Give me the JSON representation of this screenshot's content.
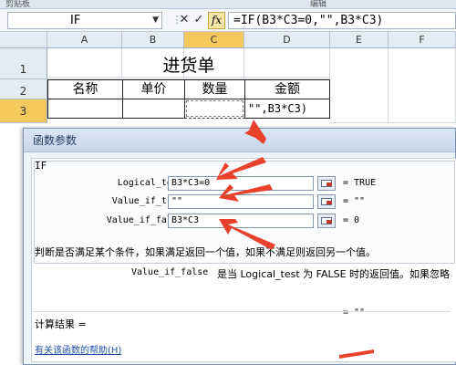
{
  "ribbon": {
    "left_label": "剪贴板",
    "right_label": "编辑"
  },
  "formula_bar": {
    "name_box": "IF",
    "cancel_glyph": "✕",
    "enter_glyph": "✓",
    "fx_label": "fx",
    "formula": "=IF(B3*C3=0,\"\",B3*C3)"
  },
  "sheet": {
    "columns": [
      "A",
      "B",
      "C",
      "D",
      "E",
      "F"
    ],
    "rows": [
      "1",
      "2",
      "3"
    ],
    "title": "进货单",
    "headers": [
      "名称",
      "单价",
      "数量",
      "金额"
    ],
    "cell_d3": "\"\",B3*C3)"
  },
  "dialog": {
    "title": "函数参数",
    "function_name": "IF",
    "args": [
      {
        "label": "Logical_test",
        "value": "B3*C3=0",
        "result": "=  TRUE"
      },
      {
        "label": "Value_if_true",
        "value": "\"\"",
        "result": "=  \"\""
      },
      {
        "label": "Value_if_false",
        "value": "B3*C3",
        "result": "=  0"
      }
    ],
    "overall_result": "=  \"\"",
    "description": "判断是否满足某个条件，如果满足返回一个值，如果不满足则返回另一个值。",
    "param_name": "Value_if_false",
    "param_help": "是当 Logical_test 为 FALSE 时的返回值。如果忽略",
    "calc_result_label": "计算结果 =",
    "help_link": "有关该函数的帮助(H)"
  },
  "colors": {
    "accent_arrow": "#e8412c",
    "selected_header": "#f5c85e"
  }
}
